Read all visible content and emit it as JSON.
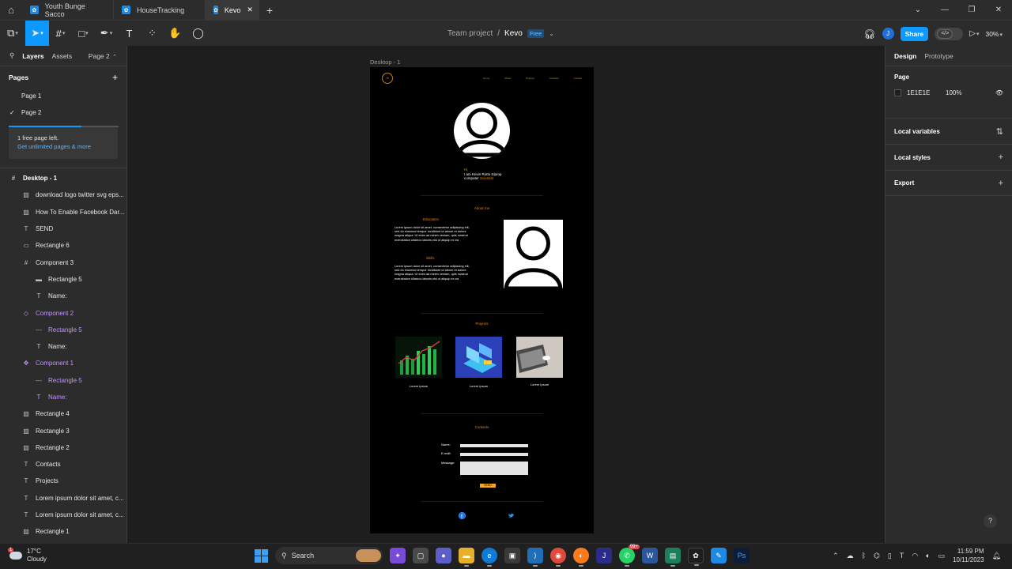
{
  "browser": {
    "tabs": [
      {
        "label": "Youth Bunge Sacco",
        "active": false
      },
      {
        "label": "HouseTracking",
        "active": false
      },
      {
        "label": "Kevo",
        "active": true
      }
    ]
  },
  "toolbar": {
    "team": "Team project",
    "separator": "/",
    "file": "Kevo",
    "plan": "Free",
    "avatar": "J",
    "share": "Share",
    "zoom": "30%"
  },
  "left_panel": {
    "tab_layers": "Layers",
    "tab_assets": "Assets",
    "current_page": "Page 2",
    "pages_title": "Pages",
    "pages": [
      {
        "label": "Page 1",
        "checked": false
      },
      {
        "label": "Page 2",
        "checked": true
      }
    ],
    "promo_text": "1 free page left.",
    "promo_link": "Get unlimited pages & more",
    "layers": [
      {
        "label": "Desktop - 1",
        "icon": "frame-icon",
        "glyph": "#",
        "indent": 0,
        "style": "bold"
      },
      {
        "label": "download logo twitter svg eps...",
        "icon": "image-icon",
        "glyph": "▨",
        "indent": 1,
        "style": ""
      },
      {
        "label": "How To Enable Facebook Dar...",
        "icon": "image-icon",
        "glyph": "▨",
        "indent": 1,
        "style": ""
      },
      {
        "label": "SEND",
        "icon": "text-icon",
        "glyph": "T",
        "indent": 1,
        "style": ""
      },
      {
        "label": "Rectangle 6",
        "icon": "rectangle-icon",
        "glyph": "▭",
        "indent": 1,
        "style": ""
      },
      {
        "label": "Component 3",
        "icon": "frame-icon",
        "glyph": "#",
        "indent": 1,
        "style": ""
      },
      {
        "label": "Rectangle 5",
        "icon": "rectangle-icon",
        "glyph": "▬",
        "indent": 2,
        "style": ""
      },
      {
        "label": "Name:",
        "icon": "text-icon",
        "glyph": "T",
        "indent": 2,
        "style": ""
      },
      {
        "label": "Component 2",
        "icon": "instance-icon",
        "glyph": "◇",
        "indent": 1,
        "style": "purple"
      },
      {
        "label": "Rectangle 5",
        "icon": "rectangle-icon",
        "glyph": "—",
        "indent": 2,
        "style": "purple"
      },
      {
        "label": "Name:",
        "icon": "text-icon",
        "glyph": "T",
        "indent": 2,
        "style": ""
      },
      {
        "label": "Component 1",
        "icon": "component-icon",
        "glyph": "✥",
        "indent": 1,
        "style": "purple"
      },
      {
        "label": "Rectangle 5",
        "icon": "rectangle-icon",
        "glyph": "—",
        "indent": 2,
        "style": "purple"
      },
      {
        "label": "Name:",
        "icon": "text-icon",
        "glyph": "T",
        "indent": 2,
        "style": "purple"
      },
      {
        "label": "Rectangle 4",
        "icon": "image-icon",
        "glyph": "▨",
        "indent": 1,
        "style": ""
      },
      {
        "label": "Rectangle 3",
        "icon": "image-icon",
        "glyph": "▨",
        "indent": 1,
        "style": ""
      },
      {
        "label": "Rectangle 2",
        "icon": "image-icon",
        "glyph": "▨",
        "indent": 1,
        "style": ""
      },
      {
        "label": "Contacts",
        "icon": "text-icon",
        "glyph": "T",
        "indent": 1,
        "style": ""
      },
      {
        "label": "Projects",
        "icon": "text-icon",
        "glyph": "T",
        "indent": 1,
        "style": ""
      },
      {
        "label": "Lorem ipsum dolor sit amet, c...",
        "icon": "text-icon",
        "glyph": "T",
        "indent": 1,
        "style": ""
      },
      {
        "label": "Lorem ipsum dolor sit amet, c...",
        "icon": "text-icon",
        "glyph": "T",
        "indent": 1,
        "style": ""
      },
      {
        "label": "Rectangle 1",
        "icon": "image-icon",
        "glyph": "▨",
        "indent": 1,
        "style": ""
      }
    ]
  },
  "canvas": {
    "frame_label": "Desktop - 1",
    "design": {
      "logo": "JK",
      "nav": [
        "Home",
        "About",
        "Projects",
        "Contacts",
        "Contact"
      ],
      "greeting": "Hi,",
      "intro": "I am Kevin Rutto Kiprop",
      "role_prefix": "computer",
      "role_highlight": "Scientist",
      "about_title": "About me",
      "education_title": "Education",
      "education_text": "Lorem ipsum dolor sit amet, consectetur adipiscing elit, sed do eiusmod tempor incididunt ut labore et dolore magna aliqua. Ut enim ad minim veniam, quis nostrud exercitation ullamco laboris nisi ut aliquip ex ea",
      "skills_title": "Skills",
      "skills_text": "Lorem ipsum dolor sit amet, consectetur adipiscing elit, sed do eiusmod tempor incididunt ut labore et dolore magna aliqua. Ut enim ad minim veniam, quis nostrud exercitation ullamco laboris nisi ut aliquip ex ea",
      "projects_title": "Projects",
      "projects": [
        {
          "label": "Lorem Ipsum"
        },
        {
          "label": "Lorem Ipsum"
        },
        {
          "label": "Lorem Ipsum"
        }
      ],
      "contacts_title": "Contacts",
      "form": {
        "name": "Name:",
        "email": "E-mail:",
        "message": "Message:",
        "send": "SEND"
      }
    }
  },
  "right_panel": {
    "tab_design": "Design",
    "tab_prototype": "Prototype",
    "page_title": "Page",
    "page_color": "1E1E1E",
    "page_opacity": "100%",
    "local_variables": "Local variables",
    "local_styles": "Local styles",
    "export": "Export",
    "help": "?"
  },
  "taskbar": {
    "temperature": "17°C",
    "condition": "Cloudy",
    "weather_badge": "1",
    "search": "Search",
    "whatsapp_badge": "99+",
    "time": "11:59 PM",
    "date": "10/11/2023"
  }
}
